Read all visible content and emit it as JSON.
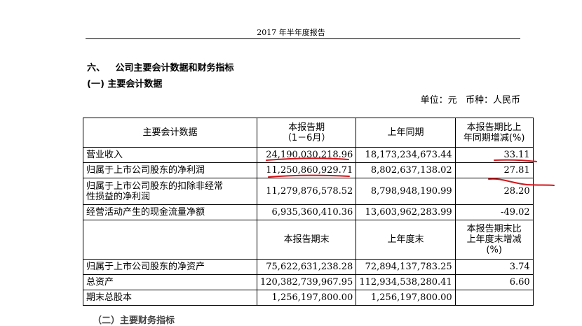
{
  "header": {
    "title": "2017 年半年度报告"
  },
  "section": {
    "number": "六、",
    "title": "公司主要会计数据和财务指标"
  },
  "subsection": {
    "title": "(一) 主要会计数据"
  },
  "unit_line": "单位：元   币种：人民币",
  "table": {
    "header1": {
      "c1": "主要会计数据",
      "c2_line1": "本报告期",
      "c2_line2": "（1－6月）",
      "c3": "上年同期",
      "c4_line1": "本报告期比上",
      "c4_line2": "年同期增减(%)"
    },
    "rows1": [
      {
        "label": "营业收入",
        "current": "24,190,030,218.96",
        "prior": "18,173,234,673.44",
        "change": "33.11"
      },
      {
        "label": "归属于上市公司股东的净利润",
        "current": "11,250,860,929.71",
        "prior": "8,802,637,138.02",
        "change": "27.81"
      },
      {
        "label_line1": "归属于上市公司股东的扣除非经常",
        "label_line2": "性损益的净利润",
        "current": "11,279,876,578.52",
        "prior": "8,798,948,190.99",
        "change": "28.20"
      },
      {
        "label": "经营活动产生的现金流量净额",
        "current": "6,935,360,410.36",
        "prior": "13,603,962,283.99",
        "change": "-49.02"
      }
    ],
    "header2": {
      "c2": "本报告期末",
      "c3": "上年度末",
      "c4_line1": "本报告期末比",
      "c4_line2": "上年度末增减",
      "c4_line3": "(%)"
    },
    "rows2": [
      {
        "label": "归属于上市公司股东的净资产",
        "current": "75,622,631,238.28",
        "prior": "72,894,137,783.25",
        "change": "3.74"
      },
      {
        "label": "总资产",
        "current": "120,382,739,967.95",
        "prior": "112,934,538,280.41",
        "change": "6.60"
      },
      {
        "label": "期末总股本",
        "current": "1,256,197,800.00",
        "prior": "1,256,197,800.00",
        "change": ""
      }
    ]
  },
  "annotation_color": "#d4151a",
  "footer_partial": "（二）主要财务指标"
}
